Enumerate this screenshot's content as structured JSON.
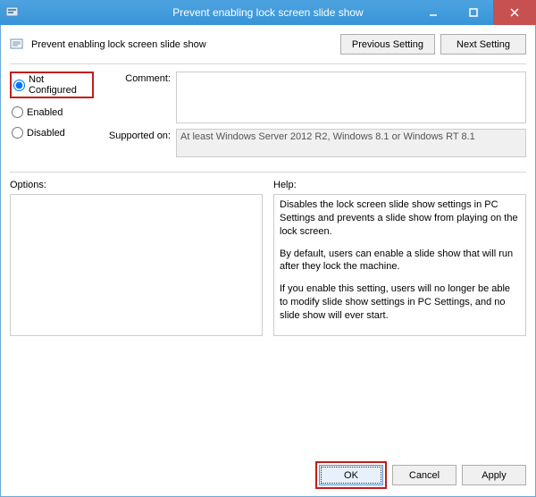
{
  "window": {
    "title": "Prevent enabling lock screen slide show"
  },
  "header": {
    "policy_name": "Prevent enabling lock screen slide show",
    "prev_btn": "Previous Setting",
    "next_btn": "Next Setting"
  },
  "state": {
    "not_configured": "Not Configured",
    "enabled": "Enabled",
    "disabled": "Disabled",
    "selected": "not_configured"
  },
  "fields": {
    "comment_label": "Comment:",
    "comment_value": "",
    "supported_label": "Supported on:",
    "supported_value": "At least Windows Server 2012 R2, Windows 8.1 or Windows RT 8.1"
  },
  "sections": {
    "options_label": "Options:",
    "help_label": "Help:"
  },
  "help": {
    "p1": "Disables the lock screen slide show settings in PC Settings and prevents a slide show from playing on the lock screen.",
    "p2": "By default, users can enable a slide show that will run after they lock the machine.",
    "p3": "If you enable this setting, users will no longer be able to modify slide show settings in PC Settings, and no slide show will ever start."
  },
  "footer": {
    "ok": "OK",
    "cancel": "Cancel",
    "apply": "Apply"
  }
}
